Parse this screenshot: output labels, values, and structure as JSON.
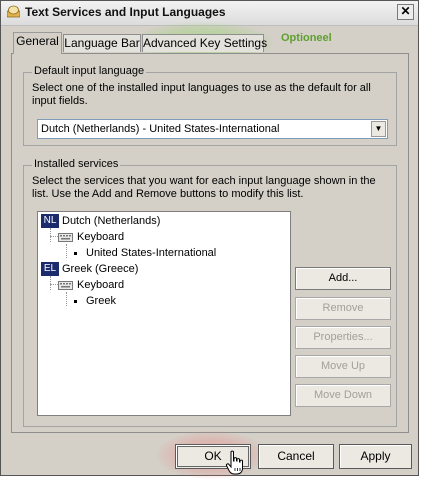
{
  "window": {
    "title": "Text Services and Input Languages",
    "close_glyph": "✕"
  },
  "tabs": [
    {
      "label": "General",
      "active": true
    },
    {
      "label": "Language Bar",
      "active": false
    },
    {
      "label": "Advanced Key Settings",
      "active": false
    }
  ],
  "annotation": {
    "optional_label": "Optioneel",
    "green_color": "#5e9f2e",
    "red_color": "#eb8282"
  },
  "default_input": {
    "legend": "Default input language",
    "description": "Select one of the installed input languages to use as the default for all input fields.",
    "selected": "Dutch (Netherlands) - United States-International"
  },
  "installed_services": {
    "legend": "Installed services",
    "description": "Select the services that you want for each input language shown in the list. Use the Add and Remove buttons to modify this list.",
    "tree": [
      {
        "badge": "NL",
        "language": "Dutch (Netherlands)",
        "category": "Keyboard",
        "layout": "United States-International"
      },
      {
        "badge": "EL",
        "language": "Greek (Greece)",
        "category": "Keyboard",
        "layout": "Greek"
      }
    ],
    "buttons": {
      "add": "Add...",
      "remove": "Remove",
      "properties": "Properties...",
      "move_up": "Move Up",
      "move_down": "Move Down"
    }
  },
  "footer": {
    "ok": "OK",
    "cancel": "Cancel",
    "apply": "Apply"
  }
}
